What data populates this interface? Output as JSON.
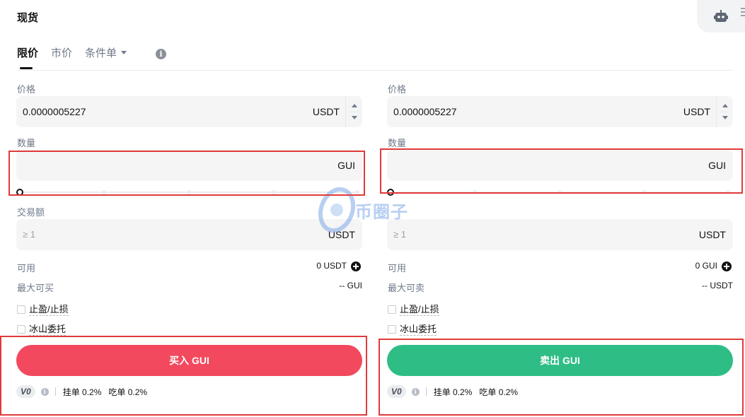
{
  "header": {
    "title": "现货",
    "robot_icon": "robot-icon",
    "menu_icon": "menu-icon"
  },
  "tabs": [
    {
      "label": "限价",
      "active": true
    },
    {
      "label": "市价",
      "active": false
    },
    {
      "label": "条件单",
      "active": false
    }
  ],
  "buy": {
    "price_label": "价格",
    "price_value": "0.0000005227",
    "price_unit": "USDT",
    "amount_label": "数量",
    "amount_unit": "GUI",
    "slider_percent": 0,
    "total_label": "交易额",
    "total_placeholder": "≥ 1",
    "total_unit": "USDT",
    "available_label": "可用",
    "available_value": "0 USDT",
    "max_label": "最大可买",
    "max_value": "-- GUI",
    "tpsl_label": "止盈/止损",
    "iceberg_label": "冰山委托",
    "button_label": "买入 GUI",
    "vip_level": "V0",
    "maker_fee": "挂单 0.2%",
    "taker_fee": "吃单 0.2%"
  },
  "sell": {
    "price_label": "价格",
    "price_value": "0.0000005227",
    "price_unit": "USDT",
    "amount_label": "数量",
    "amount_unit": "GUI",
    "slider_percent": 0,
    "total_placeholder": "≥ 1",
    "total_unit": "USDT",
    "available_label": "可用",
    "available_value": "0 GUI",
    "max_label": "最大可卖",
    "max_value": "-- USDT",
    "tpsl_label": "止盈/止损",
    "iceberg_label": "冰山委托",
    "button_label": "卖出 GUI",
    "vip_level": "V0",
    "maker_fee": "挂单 0.2%",
    "taker_fee": "吃单 0.2%"
  },
  "watermark": {
    "text": "币圈子"
  },
  "colors": {
    "buy": "#f2495e",
    "sell": "#2ebd85",
    "highlight": "#e03a3a"
  }
}
